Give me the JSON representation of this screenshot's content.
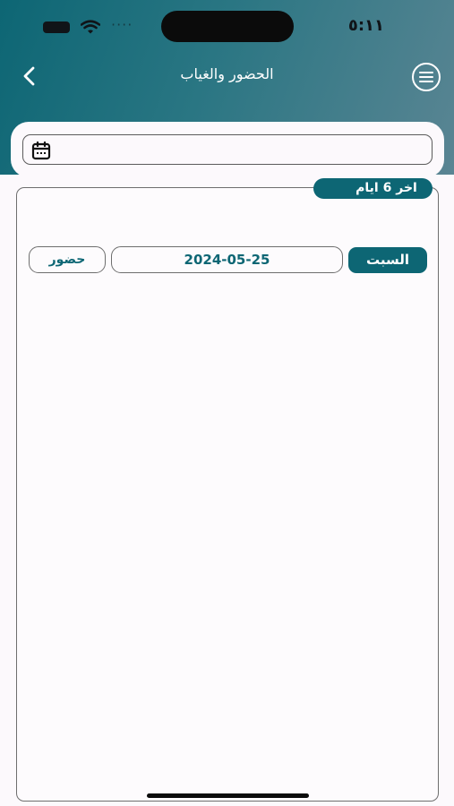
{
  "status_bar": {
    "time": "٥:١١",
    "dots": "····"
  },
  "header": {
    "title": "الحضور والغياب",
    "back_icon": "chevron-left-icon",
    "menu_icon": "menu-icon"
  },
  "date_filter": {
    "value": "",
    "icon": "calendar-icon"
  },
  "records": {
    "range_label": "اخر 6 ايام",
    "rows": [
      {
        "day": "السبت",
        "date": "2024-05-25",
        "status": "حضور"
      }
    ]
  },
  "colors": {
    "primary": "#0d6674",
    "header_gradient_end": "#5a8593",
    "background": "#fcf9fc"
  }
}
